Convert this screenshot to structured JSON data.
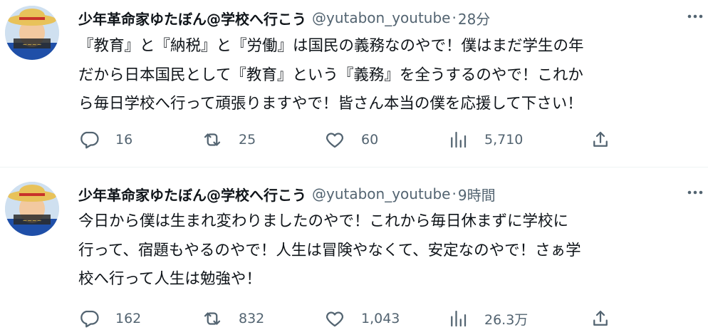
{
  "tweets": [
    {
      "display_name": "少年革命家ゆたぼん@学校へ行こう",
      "handle": "@yutabon_youtube",
      "separator": "·",
      "time": "28分",
      "lines": [
        "『教育』と『納税』と『労働』は国民の義務なのやで！僕はまだ学生の年",
        "だから日本国民として『教育』という『義務』を全うするのやで！これか",
        "ら毎日学校へ行って頑張りますやで！皆さん本当の僕を応援して下さい！"
      ],
      "replies": "16",
      "retweets": "25",
      "likes": "60",
      "views": "5,710"
    },
    {
      "display_name": "少年革命家ゆたぼん@学校へ行こう",
      "handle": "@yutabon_youtube",
      "separator": "·",
      "time": "9時間",
      "lines": [
        "今日から僕は生まれ変わりましたのやで！これから毎日休まずに学校に",
        "行って、宿題もやるのやで！人生は冒険やなくて、安定なのやで！さぁ学",
        "校へ行って人生は勉強や！"
      ],
      "replies": "162",
      "retweets": "832",
      "likes": "1,043",
      "views": "26.3万"
    }
  ],
  "icons": {
    "reply": "reply-icon",
    "retweet": "retweet-icon",
    "like": "heart-icon",
    "views": "views-icon",
    "share": "share-icon",
    "more": "more-icon"
  },
  "colors": {
    "text": "#0f1419",
    "secondary": "#536471",
    "divider": "#eff3f4"
  }
}
